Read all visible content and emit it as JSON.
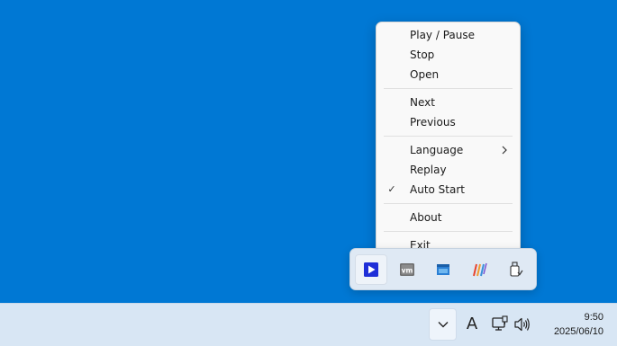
{
  "context_menu": {
    "items": [
      {
        "label": "Play / Pause"
      },
      {
        "label": "Stop"
      },
      {
        "label": "Open"
      },
      {
        "label": "Next"
      },
      {
        "label": "Previous"
      },
      {
        "label": "Language",
        "has_submenu": true
      },
      {
        "label": "Replay"
      },
      {
        "label": "Auto Start",
        "checked": true,
        "check_glyph": "✓"
      },
      {
        "label": "About"
      },
      {
        "label": "Exit"
      }
    ]
  },
  "tray_flyout": {
    "icons": [
      {
        "name": "media-player-icon",
        "active": true
      },
      {
        "name": "vmware-icon",
        "badge_text": "vm"
      },
      {
        "name": "window-app-icon"
      },
      {
        "name": "stripes-app-icon"
      },
      {
        "name": "usb-drive-icon"
      }
    ]
  },
  "taskbar": {
    "ime_label": "A",
    "clock": {
      "time": "9:50",
      "date": "2025/06/10"
    }
  },
  "colors": {
    "desktop": "#0078d4",
    "taskbar": "#d8e6f4",
    "menu_bg": "#f9f9f9",
    "play_icon": "#1f2fd8"
  }
}
